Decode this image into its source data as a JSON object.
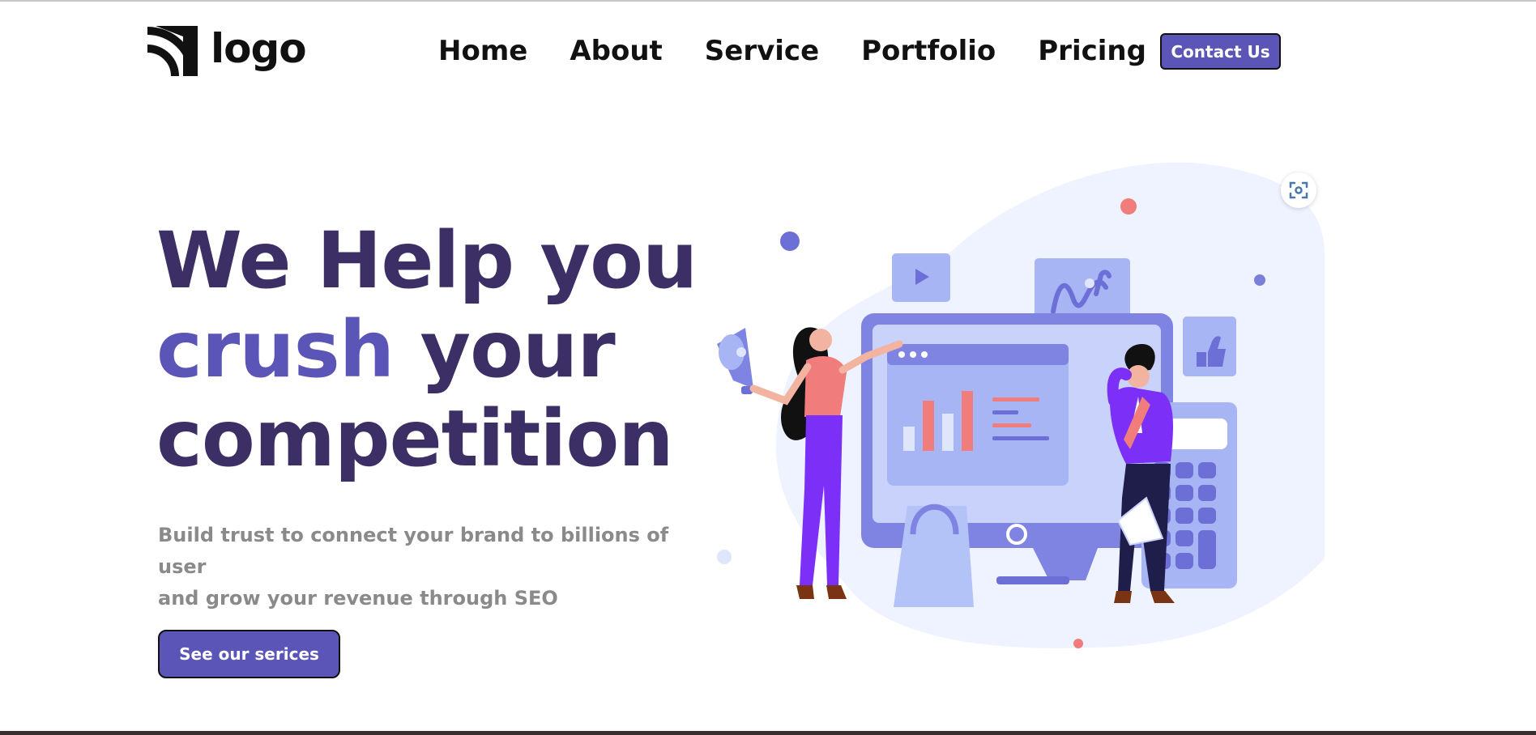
{
  "header": {
    "logo_text": "logo",
    "nav": [
      "Home",
      "About",
      "Service",
      "Portfolio",
      "Pricing"
    ],
    "contact_label": "Contact Us"
  },
  "hero": {
    "title_line1": "We Help you",
    "title_accent": "crush",
    "title_line2_rest": " your",
    "title_line3": "competition",
    "subtitle_line1": "Build trust to connect your brand to billions of user",
    "subtitle_line2": "and grow your revenue through SEO",
    "cta_label": "See our serices"
  },
  "colors": {
    "brand": "#5b55b8",
    "heading": "#3c2f66",
    "subtitle": "#8a8a8a"
  },
  "icons": {
    "logo": "wifi-arcs-icon",
    "scan": "scan-icon"
  }
}
